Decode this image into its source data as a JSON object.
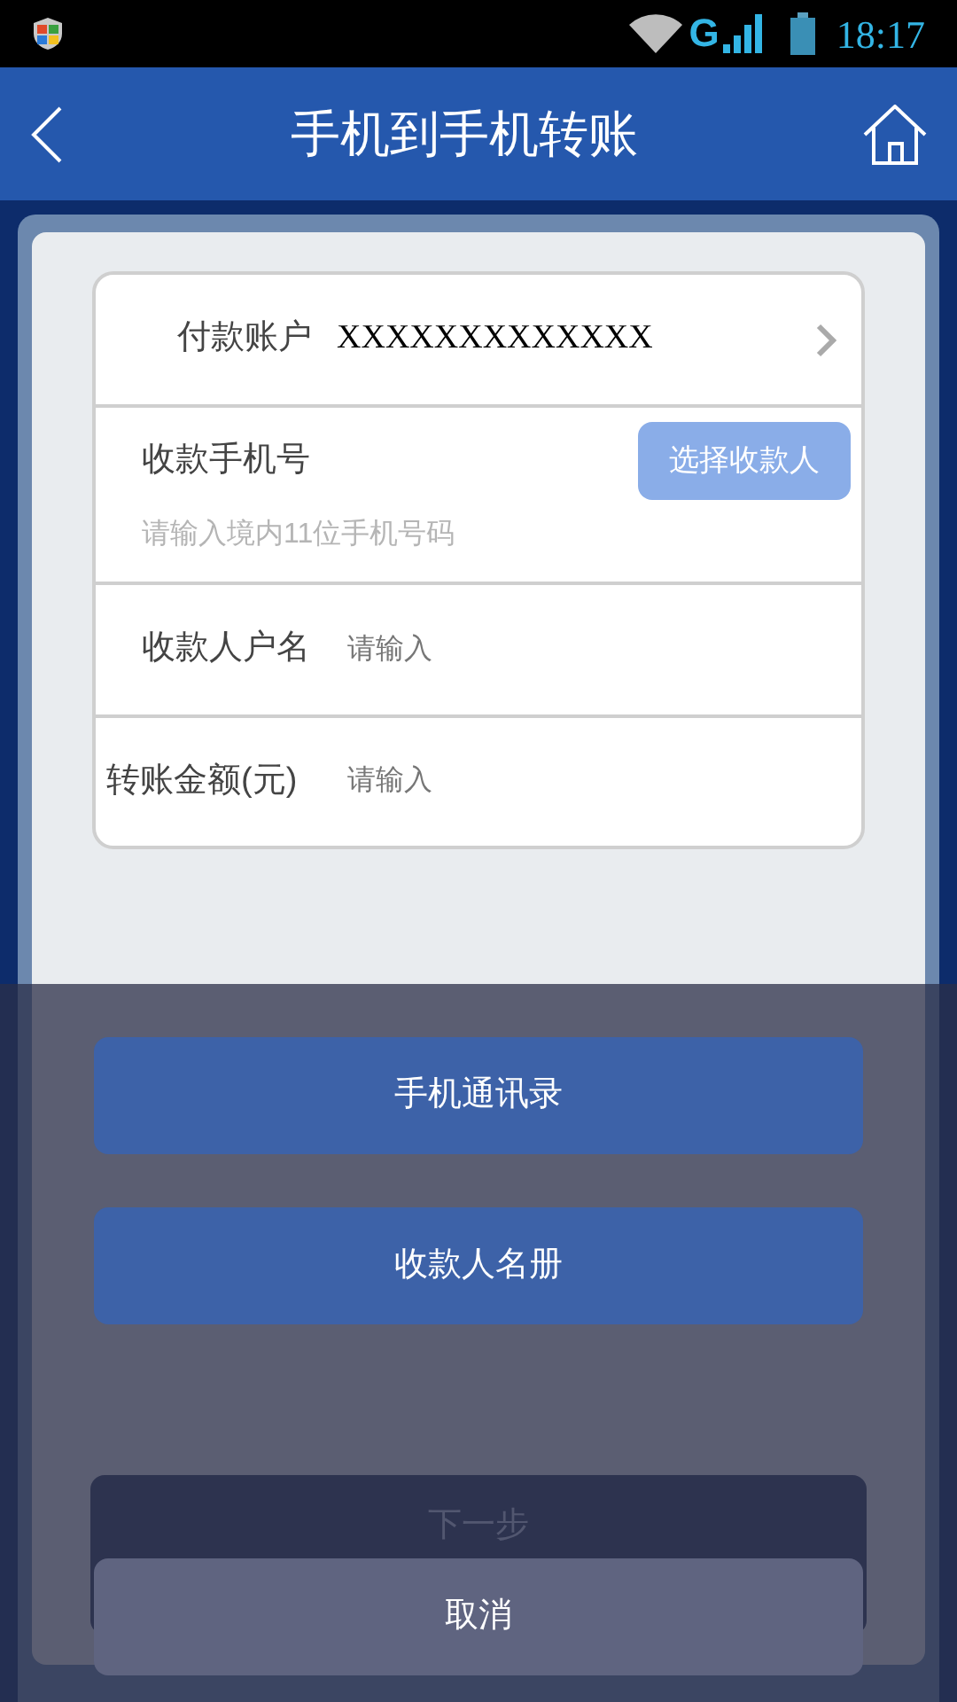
{
  "status_bar": {
    "time": "18:17",
    "network": "G"
  },
  "header": {
    "title": "手机到手机转账"
  },
  "form": {
    "payer_account": {
      "label": "付款账户",
      "value": "XXXXXXXXXXXXX"
    },
    "payee_phone": {
      "label": "收款手机号",
      "button": "选择收款人",
      "placeholder": "请输入境内11位手机号码"
    },
    "payee_name": {
      "label": "收款人户名",
      "placeholder": "请输入"
    },
    "amount": {
      "label": "转账金额(元)",
      "placeholder": "请输入"
    }
  },
  "next_button": "下一步",
  "sheet": {
    "options": [
      "手机通讯录",
      "收款人名册"
    ],
    "cancel": "取消"
  }
}
